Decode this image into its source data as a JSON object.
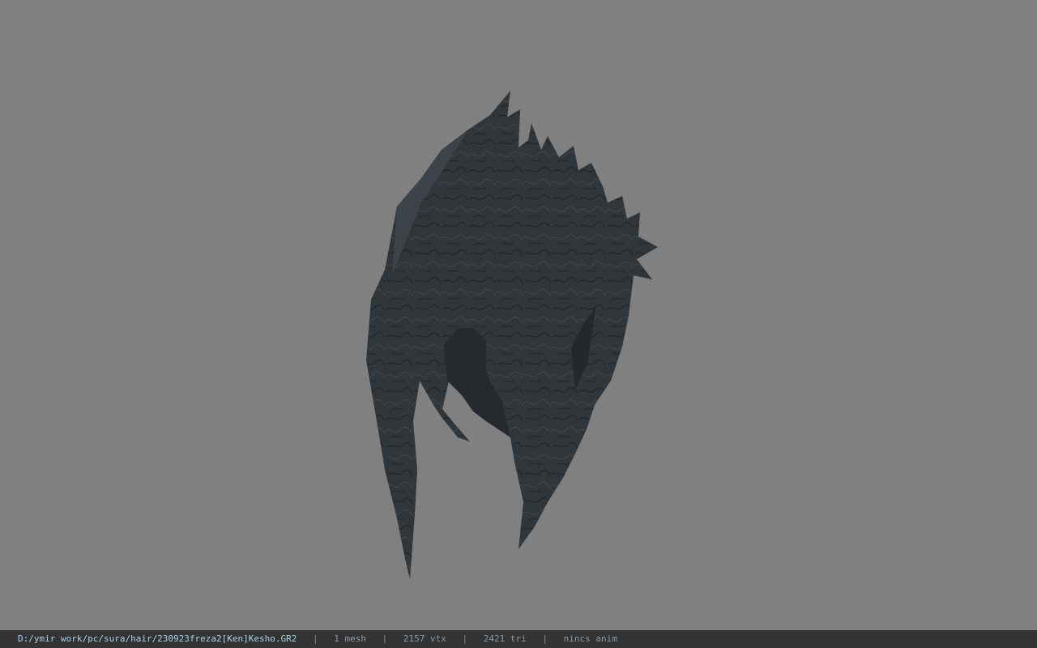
{
  "viewport": {
    "background": "#808080",
    "model": {
      "color": "#31363b",
      "type": "hair-mesh"
    }
  },
  "status_bar": {
    "path": "D:/ymir work/pc/sura/hair/230923freza2[Ken]Kesho.GR2",
    "separator": "|",
    "mesh_count": "1 mesh",
    "vertex_count": "2157 vtx",
    "triangle_count": "2421 tri",
    "animation": "nincs anim"
  }
}
